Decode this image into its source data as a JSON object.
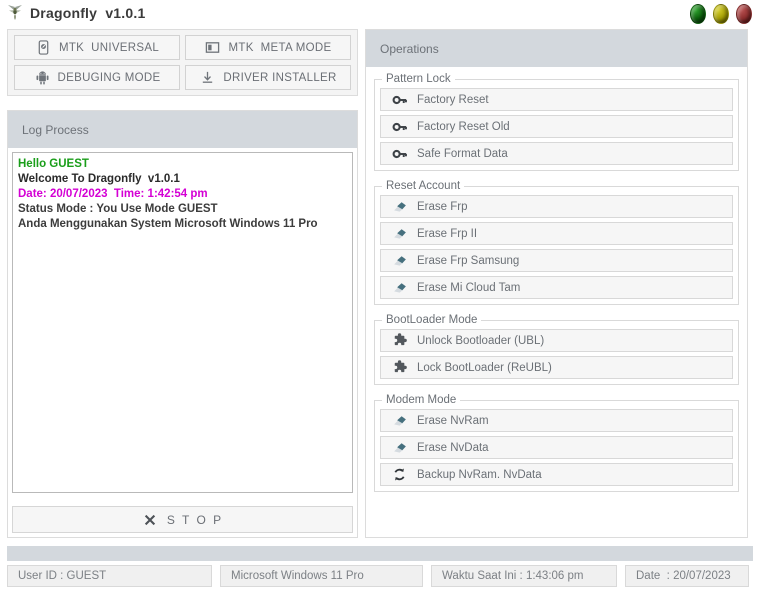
{
  "window": {
    "title": "Dragonfly  v1.0.1",
    "logo_icon": "dragonfly-icon",
    "controls": [
      {
        "name": "minimize-button",
        "color": "#0b5d0b"
      },
      {
        "name": "maximize-button",
        "color": "#a09a00"
      },
      {
        "name": "close-button",
        "color": "#8c2d2d"
      }
    ]
  },
  "mode_buttons": [
    {
      "label": "MTK  UNIVERSAL",
      "icon": "phone-icon",
      "name": "mtk-universal-button"
    },
    {
      "label": "MTK  META MODE",
      "icon": "meta-window-icon",
      "name": "mtk-meta-mode-button"
    },
    {
      "label": "DEBUGING MODE",
      "icon": "android-icon",
      "name": "debuging-mode-button"
    },
    {
      "label": "DRIVER INSTALLER",
      "icon": "download-icon",
      "name": "driver-installer-button"
    }
  ],
  "log": {
    "header": "Log Process",
    "lines": [
      {
        "text": "Hello GUEST",
        "color": "#1a9e1a"
      },
      {
        "text": "Welcome To Dragonfly  v1.0.1",
        "color": "#2b2b2b"
      },
      {
        "text": "Date: 20/07/2023  Time: 1:42:54 pm",
        "color": "#d400d4"
      },
      {
        "text": "Status Mode : You Use Mode GUEST",
        "color": "#3c3c3c"
      },
      {
        "text": "Anda Menggunakan System Microsoft Windows 11 Pro",
        "color": "#3c3c3c"
      }
    ],
    "stop_label": "S T O P",
    "stop_icon": "close-x-icon"
  },
  "operations": {
    "header": "Operations",
    "groups": [
      {
        "legend": "Pattern Lock",
        "items": [
          {
            "label": "Factory Reset",
            "icon": "key-icon",
            "name": "factory-reset-button"
          },
          {
            "label": "Factory Reset Old",
            "icon": "key-icon",
            "name": "factory-reset-old-button"
          },
          {
            "label": "Safe Format Data",
            "icon": "key-icon",
            "name": "safe-format-data-button"
          }
        ]
      },
      {
        "legend": "Reset Account",
        "items": [
          {
            "label": "Erase Frp",
            "icon": "eraser-icon",
            "name": "erase-frp-button"
          },
          {
            "label": "Erase Frp II",
            "icon": "eraser-icon",
            "name": "erase-frp-ii-button"
          },
          {
            "label": "Erase Frp Samsung",
            "icon": "eraser-icon",
            "name": "erase-frp-samsung-button"
          },
          {
            "label": "Erase Mi Cloud Tam",
            "icon": "eraser-icon",
            "name": "erase-mi-cloud-tam-button"
          }
        ]
      },
      {
        "legend": "BootLoader Mode",
        "items": [
          {
            "label": "Unlock Bootloader (UBL)",
            "icon": "puzzle-icon",
            "name": "unlock-bootloader-button"
          },
          {
            "label": "Lock BootLoader (ReUBL)",
            "icon": "puzzle-icon",
            "name": "lock-bootloader-button"
          }
        ]
      },
      {
        "legend": "Modem Mode",
        "items": [
          {
            "label": "Erase NvRam",
            "icon": "eraser-icon",
            "name": "erase-nvram-button"
          },
          {
            "label": "Erase NvData",
            "icon": "eraser-icon",
            "name": "erase-nvdata-button"
          },
          {
            "label": "Backup NvRam. NvData",
            "icon": "refresh-icon",
            "name": "backup-nvram-nvdata-button"
          }
        ]
      }
    ]
  },
  "status_bar": {
    "user": "User ID : GUEST",
    "os": "Microsoft Windows 11 Pro",
    "time": "Waktu Saat Ini : 1:43:06 pm",
    "date": "Date  : 20/07/2023"
  }
}
